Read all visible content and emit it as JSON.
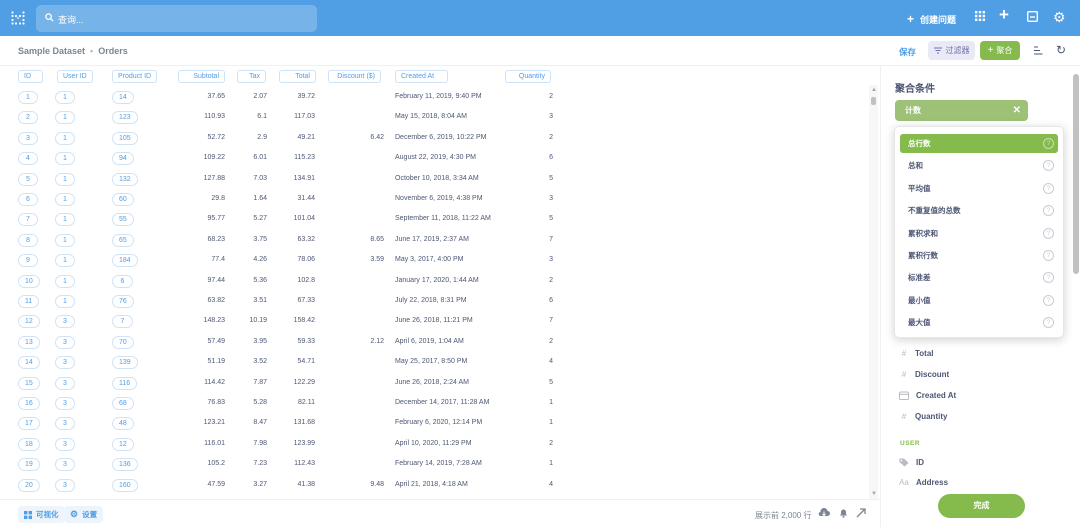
{
  "topbar": {
    "search_placeholder": "查询...",
    "create_question": "创建问题",
    "colors": {
      "bg": "#509ee3"
    }
  },
  "header": {
    "breadcrumb": [
      "Sample Dataset",
      "Orders"
    ],
    "save": "保存",
    "filter": "过滤器",
    "aggregate": "聚合"
  },
  "table": {
    "columns": [
      "ID",
      "User ID",
      "Product ID",
      "Subtotal",
      "Tax",
      "Total",
      "Discount ($)",
      "Created At",
      "Quantity"
    ],
    "rows": [
      [
        "1",
        "1",
        "14",
        "37.65",
        "2.07",
        "39.72",
        "",
        "February 11, 2019, 9:40 PM",
        "2"
      ],
      [
        "2",
        "1",
        "123",
        "110.93",
        "6.1",
        "117.03",
        "",
        "May 15, 2018, 8:04 AM",
        "3"
      ],
      [
        "3",
        "1",
        "105",
        "52.72",
        "2.9",
        "49.21",
        "6.42",
        "December 6, 2019, 10:22 PM",
        "2"
      ],
      [
        "4",
        "1",
        "94",
        "109.22",
        "6.01",
        "115.23",
        "",
        "August 22, 2019, 4:30 PM",
        "6"
      ],
      [
        "5",
        "1",
        "132",
        "127.88",
        "7.03",
        "134.91",
        "",
        "October 10, 2018, 3:34 AM",
        "5"
      ],
      [
        "6",
        "1",
        "60",
        "29.8",
        "1.64",
        "31.44",
        "",
        "November 6, 2019, 4:38 PM",
        "3"
      ],
      [
        "7",
        "1",
        "55",
        "95.77",
        "5.27",
        "101.04",
        "",
        "September 11, 2018, 11:22 AM",
        "5"
      ],
      [
        "8",
        "1",
        "65",
        "68.23",
        "3.75",
        "63.32",
        "8.65",
        "June 17, 2019, 2:37 AM",
        "7"
      ],
      [
        "9",
        "1",
        "184",
        "77.4",
        "4.26",
        "78.06",
        "3.59",
        "May 3, 2017, 4:00 PM",
        "3"
      ],
      [
        "10",
        "1",
        "6",
        "97.44",
        "5.36",
        "102.8",
        "",
        "January 17, 2020, 1:44 AM",
        "2"
      ],
      [
        "11",
        "1",
        "76",
        "63.82",
        "3.51",
        "67.33",
        "",
        "July 22, 2018, 8:31 PM",
        "6"
      ],
      [
        "12",
        "3",
        "7",
        "148.23",
        "10.19",
        "158.42",
        "",
        "June 26, 2018, 11:21 PM",
        "7"
      ],
      [
        "13",
        "3",
        "70",
        "57.49",
        "3.95",
        "59.33",
        "2.12",
        "April 6, 2019, 1:04 AM",
        "2"
      ],
      [
        "14",
        "3",
        "139",
        "51.19",
        "3.52",
        "54.71",
        "",
        "May 25, 2017, 8:50 PM",
        "4"
      ],
      [
        "15",
        "3",
        "116",
        "114.42",
        "7.87",
        "122.29",
        "",
        "June 26, 2018, 2:24 AM",
        "5"
      ],
      [
        "16",
        "3",
        "68",
        "76.83",
        "5.28",
        "82.11",
        "",
        "December 14, 2017, 11:28 AM",
        "1"
      ],
      [
        "17",
        "3",
        "48",
        "123.21",
        "8.47",
        "131.68",
        "",
        "February 6, 2020, 12:14 PM",
        "1"
      ],
      [
        "18",
        "3",
        "12",
        "116.01",
        "7.98",
        "123.99",
        "",
        "April 10, 2020, 11:29 PM",
        "2"
      ],
      [
        "19",
        "3",
        "136",
        "105.2",
        "7.23",
        "112.43",
        "",
        "February 14, 2019, 7:28 AM",
        "1"
      ],
      [
        "20",
        "3",
        "160",
        "47.59",
        "3.27",
        "41.38",
        "9.48",
        "April 21, 2018, 4:18 AM",
        "4"
      ]
    ]
  },
  "footer": {
    "visualize": "可视化",
    "settings": "设置",
    "row_count": "展示前 2,000 行"
  },
  "sidebar": {
    "title": "聚合条件",
    "selected": "计数",
    "options": [
      "总行数",
      "总和",
      "平均值",
      "不重复值的总数",
      "累积求和",
      "累积行数",
      "标准差",
      "最小值",
      "最大值"
    ],
    "fields": [
      {
        "icon": "#",
        "label": "Total"
      },
      {
        "icon": "#",
        "label": "Discount"
      },
      {
        "icon": "calendar",
        "label": "Created At"
      },
      {
        "icon": "#",
        "label": "Quantity"
      }
    ],
    "section_user": "USER",
    "user_fields": [
      {
        "icon": "tag",
        "label": "ID"
      },
      {
        "icon": "Aa",
        "label": "Address"
      }
    ],
    "done": "完成",
    "accent": "#84bb4c"
  }
}
